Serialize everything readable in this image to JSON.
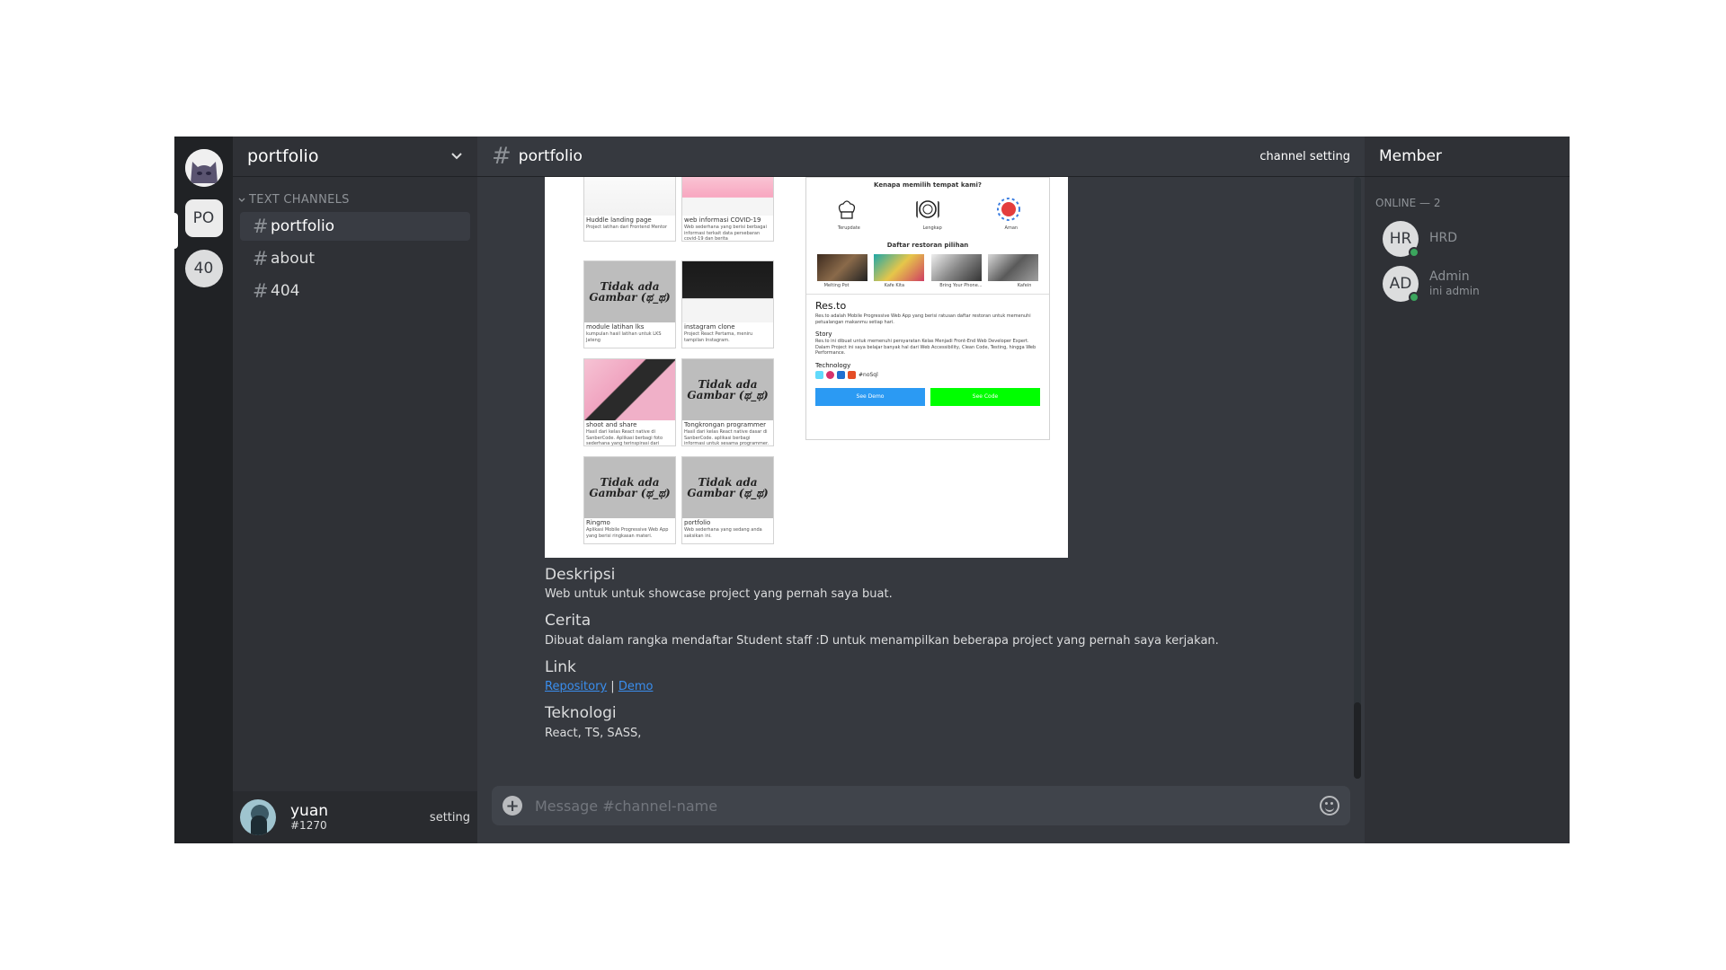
{
  "servers": [
    {
      "label": "PO",
      "active": true
    },
    {
      "label": "40",
      "active": false
    }
  ],
  "guild": {
    "name": "portfolio"
  },
  "category": "TEXT CHANNELS",
  "channels": [
    {
      "name": "portfolio"
    },
    {
      "name": "about"
    },
    {
      "name": "404"
    }
  ],
  "user": {
    "name": "yuan",
    "tag": "#1270",
    "setting": "setting"
  },
  "header": {
    "channel": "portfolio",
    "setting": "channel setting"
  },
  "preview": {
    "cards": [
      {
        "title": "Huddle landing page",
        "desc": "Project latihan dari Frontend Mentor"
      },
      {
        "title": "web informasi COVID-19",
        "desc": "Web sederhana yang berisi berbagai informasi terkait data persebaran covid-19 dan berita"
      },
      {
        "title": "module latihan lks",
        "desc": "kumpulan hasil latihan untuk LKS Jateng",
        "placeholder": "Tidak ada Gambar (ಥ_ಥ)"
      },
      {
        "title": "instagram clone",
        "desc": "Project React Pertama, meniru tampilan Instagram."
      },
      {
        "title": "shoot and share",
        "desc": "Hasil dari kelas React native di SanberCode. Aplikasi berbagi foto sederhana yang terinspirasi dari"
      },
      {
        "title": "Tongkrongan programmer",
        "desc": "Hasil dari kelas React native dasar di SanberCode. aplikasi berbagi informasi untuk sesama programmer.",
        "placeholder": "Tidak ada Gambar (ಥ_ಥ)"
      },
      {
        "title": "Ringmo",
        "desc": "Aplikasi Mobile Progressive Web App yang berisi ringkasan materi.",
        "placeholder": "Tidak ada Gambar (ಥ_ಥ)"
      },
      {
        "title": "portfolio",
        "desc": "Web sederhana yang sedang anda saksikan ini.",
        "placeholder": "Tidak ada Gambar (ಥ_ಥ)"
      }
    ],
    "resto": {
      "question": "Kenapa memilih tempat kami?",
      "features": [
        "Terupdate",
        "Lengkap",
        "Aman"
      ],
      "list_title": "Daftar restoran pilihan",
      "restaurants": [
        "Melting Pot",
        "Kafe Kita",
        "Bring Your Phone...",
        "Kafein"
      ],
      "name": "Res.to",
      "about": "Res.to adalah Mobile Progressive Web App yang berisi ratusan daftar restoran untuk memenuhi petualangan makanmu setiap hari.",
      "story_h": "Story",
      "story": "Res.to ini dibuat untuk memenuhi persyaratan Kelas Menjadi Front-End Web Developer Expert. Dalam Project ini saya belajar banyak hal dari Web Accessibility, Clean Code, Testing, hingga Web Performance.",
      "tech_h": "Technology",
      "tech_tag": "#noSql",
      "demo": "See Demo",
      "code": "See Code"
    }
  },
  "sections": {
    "deskripsi_h": "Deskripsi",
    "deskripsi": "Web untuk untuk showcase project yang pernah saya buat.",
    "cerita_h": "Cerita",
    "cerita": "Dibuat dalam rangka mendaftar Student staff :D untuk menampilkan beberapa project yang pernah saya kerjakan.",
    "link_h": "Link",
    "repo": "Repository",
    "sep": "|",
    "demo": "Demo",
    "tek_h": "Teknologi",
    "tek": "React, TS, SASS,"
  },
  "composer": {
    "placeholder": "Message #channel-name"
  },
  "members": {
    "title": "Member",
    "online": "ONLINE — 2",
    "list": [
      {
        "initials": "HR",
        "name": "HRD",
        "sub": ""
      },
      {
        "initials": "AD",
        "name": "Admin",
        "sub": "ini admin"
      }
    ]
  },
  "colors": {
    "online": "#3ba55d",
    "link": "#3a8eee",
    "demo_btn": "#2b9af3",
    "code_btn": "#00ff00"
  }
}
